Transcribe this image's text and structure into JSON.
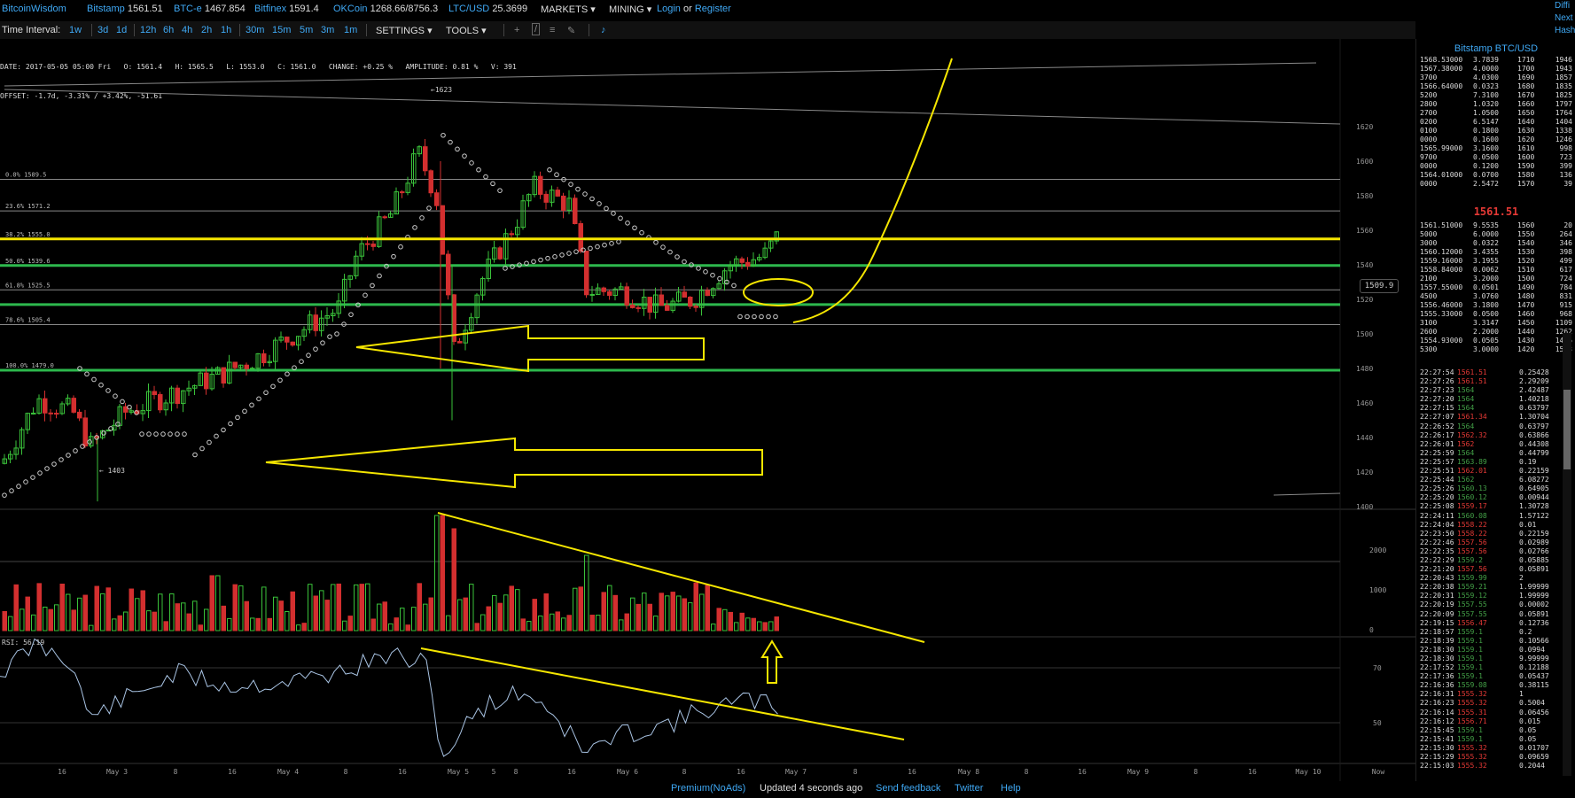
{
  "topbar": {
    "brand": "BitcoinWisdom",
    "exchanges": [
      {
        "name": "Bitstamp",
        "price": "1561.51"
      },
      {
        "name": "BTC-e",
        "price": "1467.854"
      },
      {
        "name": "Bitfinex",
        "price": "1591.4"
      },
      {
        "name": "OKCoin",
        "price": "1268.66/8756.3"
      },
      {
        "name": "LTC/USD",
        "price": "25.3699"
      }
    ],
    "markets_label": "MARKETS",
    "mining_label": "MINING",
    "login_label": "Login",
    "or_label": "or",
    "register_label": "Register"
  },
  "edge_text": [
    "Diffi",
    "Next",
    "Hash"
  ],
  "toolbar": {
    "time_interval_label": "Time Interval:",
    "intervals": [
      "1w",
      "3d",
      "1d",
      "12h",
      "6h",
      "4h",
      "2h",
      "1h",
      "30m",
      "15m",
      "5m",
      "3m",
      "1m"
    ],
    "settings_label": "SETTINGS",
    "tools_label": "TOOLS"
  },
  "info": {
    "line1": "DATE: 2017-05-05 05:00 Fri   O: 1561.4   H: 1565.5   L: 1553.0   C: 1561.0   CHANGE: +0.25 %   AMPLITUDE: 0.81 %   V: 391",
    "line2": "OFFSET: -1.7d, -3.31% / +3.42%, -51.61"
  },
  "chart": {
    "price_ticks": [
      "1620",
      "1600",
      "1580",
      "1560",
      "1540",
      "1520",
      "1500",
      "1480",
      "1460",
      "1440",
      "1420",
      "1400"
    ],
    "fib_labels": [
      "0.0% 1589.5",
      "23.6% 1571.2",
      "38.2% 1555.0",
      "50.0% 1539.6",
      "61.8% 1525.5",
      "78.6% 1505.4",
      "100.0% 1479.0"
    ],
    "high_label": "1623",
    "low_label": "1403",
    "price_marker": "1509.9",
    "volume_ticks": [
      "2000",
      "1000",
      "0"
    ],
    "rsi_label": "RSI: 56.19",
    "rsi_ticks": [
      "70",
      "50"
    ],
    "x_labels": [
      "16",
      "May 3",
      "8",
      "16",
      "May 4",
      "8",
      "16",
      "May 5",
      "5",
      "8",
      "16",
      "May 6",
      "8",
      "16",
      "May 7",
      "8",
      "16",
      "May 8",
      "8",
      "16",
      "May 9",
      "8",
      "16",
      "May 10",
      "Now"
    ]
  },
  "sidebar": {
    "title": "Bitstamp BTC/USD",
    "asks": [
      [
        "1568.53000",
        "3.7839",
        "1710",
        "1946"
      ],
      [
        "1567.38000",
        "4.0000",
        "1700",
        "1943"
      ],
      [
        "3700",
        "4.0300",
        "1690",
        "1857"
      ],
      [
        "1566.64000",
        "0.0323",
        "1680",
        "1835"
      ],
      [
        "5200",
        "7.3100",
        "1670",
        "1825"
      ],
      [
        "2800",
        "1.0320",
        "1660",
        "1797"
      ],
      [
        "2700",
        "1.0500",
        "1650",
        "1764"
      ],
      [
        "0200",
        "6.5147",
        "1640",
        "1404"
      ],
      [
        "0100",
        "0.1800",
        "1630",
        "1338"
      ],
      [
        "0000",
        "0.1600",
        "1620",
        "1246"
      ],
      [
        "1565.99000",
        "3.1600",
        "1610",
        "998"
      ],
      [
        "9700",
        "0.0500",
        "1600",
        "723"
      ],
      [
        "0000",
        "0.1200",
        "1590",
        "399"
      ],
      [
        "1564.01000",
        "0.0700",
        "1580",
        "136"
      ],
      [
        "0000",
        "2.5472",
        "1570",
        "39"
      ]
    ],
    "last_price": "1561.51",
    "bids": [
      [
        "1561.51000",
        "9.5535",
        "1560",
        "20"
      ],
      [
        "5000",
        "6.0000",
        "1550",
        "264"
      ],
      [
        "3000",
        "0.0322",
        "1540",
        "346"
      ],
      [
        "1560.12000",
        "3.4355",
        "1530",
        "398"
      ],
      [
        "1559.16000",
        "3.1955",
        "1520",
        "499"
      ],
      [
        "1558.84000",
        "0.0062",
        "1510",
        "617"
      ],
      [
        "2100",
        "3.2000",
        "1500",
        "724"
      ],
      [
        "1557.55000",
        "0.0501",
        "1490",
        "784"
      ],
      [
        "4500",
        "3.0760",
        "1480",
        "831"
      ],
      [
        "1556.46000",
        "3.1800",
        "1470",
        "915"
      ],
      [
        "1555.33000",
        "0.0500",
        "1460",
        "968"
      ],
      [
        "3100",
        "3.3147",
        "1450",
        "1109"
      ],
      [
        "2600",
        "2.2000",
        "1440",
        "1262"
      ],
      [
        "1554.93000",
        "0.0505",
        "1430",
        "1446"
      ],
      [
        "5300",
        "3.0000",
        "1420",
        "1533"
      ]
    ],
    "trades": [
      [
        "22:27:54",
        "1561.51",
        "0.25428",
        "red"
      ],
      [
        "22:27:26",
        "1561.51",
        "2.29209",
        "red"
      ],
      [
        "22:27:23",
        "1564",
        "2.42487",
        "green"
      ],
      [
        "22:27:20",
        "1564",
        "1.40218",
        "green"
      ],
      [
        "22:27:15",
        "1564",
        "0.63797",
        "green"
      ],
      [
        "22:27:07",
        "1561.34",
        "1.30704",
        "red"
      ],
      [
        "22:26:52",
        "1564",
        "0.63797",
        "green"
      ],
      [
        "22:26:17",
        "1562.32",
        "0.63866",
        "red"
      ],
      [
        "22:26:01",
        "1562",
        "0.44308",
        "red"
      ],
      [
        "22:25:59",
        "1564",
        "0.44799",
        "green"
      ],
      [
        "22:25:57",
        "1563.89",
        "0.19",
        "green"
      ],
      [
        "22:25:51",
        "1562.01",
        "0.22159",
        "red"
      ],
      [
        "22:25:44",
        "1562",
        "6.08272",
        "green"
      ],
      [
        "22:25:26",
        "1560.13",
        "0.64905",
        "green"
      ],
      [
        "22:25:20",
        "1560.12",
        "0.00944",
        "green"
      ],
      [
        "22:25:08",
        "1559.17",
        "1.30728",
        "red"
      ],
      [
        "22:24:11",
        "1560.08",
        "1.57122",
        "green"
      ],
      [
        "22:24:04",
        "1558.22",
        "0.01",
        "red"
      ],
      [
        "22:23:50",
        "1558.22",
        "0.22159",
        "red"
      ],
      [
        "22:22:46",
        "1557.56",
        "0.02989",
        "red"
      ],
      [
        "22:22:35",
        "1557.56",
        "0.02766",
        "red"
      ],
      [
        "22:22:29",
        "1559.2",
        "0.05885",
        "green"
      ],
      [
        "22:21:20",
        "1557.56",
        "0.05891",
        "red"
      ],
      [
        "22:20:43",
        "1559.99",
        "2",
        "green"
      ],
      [
        "22:20:38",
        "1559.21",
        "1.99999",
        "green"
      ],
      [
        "22:20:31",
        "1559.12",
        "1.99999",
        "green"
      ],
      [
        "22:20:19",
        "1557.55",
        "0.00002",
        "green"
      ],
      [
        "22:20:09",
        "1557.55",
        "0.05891",
        "green"
      ],
      [
        "22:19:15",
        "1556.47",
        "0.12736",
        "red"
      ],
      [
        "22:18:57",
        "1559.1",
        "0.2",
        "green"
      ],
      [
        "22:18:39",
        "1559.1",
        "0.10566",
        "green"
      ],
      [
        "22:18:30",
        "1559.1",
        "0.0994",
        "green"
      ],
      [
        "22:18:30",
        "1559.1",
        "9.99999",
        "green"
      ],
      [
        "22:17:52",
        "1559.1",
        "0.12188",
        "green"
      ],
      [
        "22:17:36",
        "1559.1",
        "0.05437",
        "green"
      ],
      [
        "22:16:36",
        "1559.08",
        "0.38115",
        "green"
      ],
      [
        "22:16:31",
        "1555.32",
        "1",
        "red"
      ],
      [
        "22:16:23",
        "1555.32",
        "0.5004",
        "red"
      ],
      [
        "22:16:14",
        "1555.31",
        "0.06456",
        "red"
      ],
      [
        "22:16:12",
        "1556.71",
        "0.015",
        "red"
      ],
      [
        "22:15:45",
        "1559.1",
        "0.05",
        "green"
      ],
      [
        "22:15:41",
        "1559.1",
        "0.05",
        "green"
      ],
      [
        "22:15:30",
        "1555.32",
        "0.01707",
        "red"
      ],
      [
        "22:15:29",
        "1555.32",
        "0.09659",
        "red"
      ],
      [
        "22:15:03",
        "1555.32",
        "0.2044",
        "red"
      ]
    ]
  },
  "footer": {
    "premium": "Premium(NoAds)",
    "updated": "Updated 4 seconds ago",
    "feedback": "Send feedback",
    "twitter": "Twitter",
    "help": "Help"
  }
}
